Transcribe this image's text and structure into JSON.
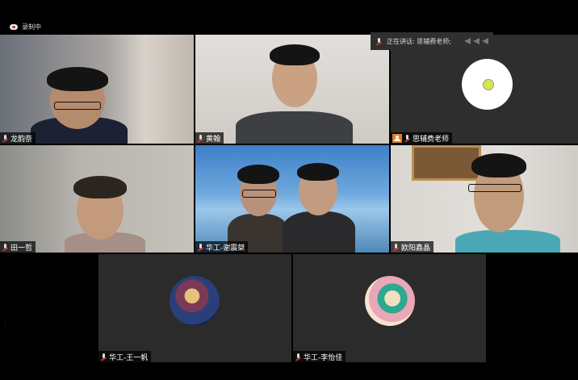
{
  "recording": {
    "label": "录制中"
  },
  "speaking": {
    "label": "正在讲话: 思辅费老师;"
  },
  "participants": [
    {
      "name": "龙韵奈"
    },
    {
      "name": "黄翰"
    },
    {
      "name": "思辅费老师"
    },
    {
      "name": "田一哲"
    },
    {
      "name": "华工-谢震桀"
    },
    {
      "name": "欧阳鑫晶"
    },
    {
      "name": "华工-王一帆"
    },
    {
      "name": "华工-李怡佳"
    }
  ],
  "colors": {
    "host_badge": "#e87a25",
    "muted_mic": "#c0392b",
    "tile_bg": "#2b2b2b"
  }
}
